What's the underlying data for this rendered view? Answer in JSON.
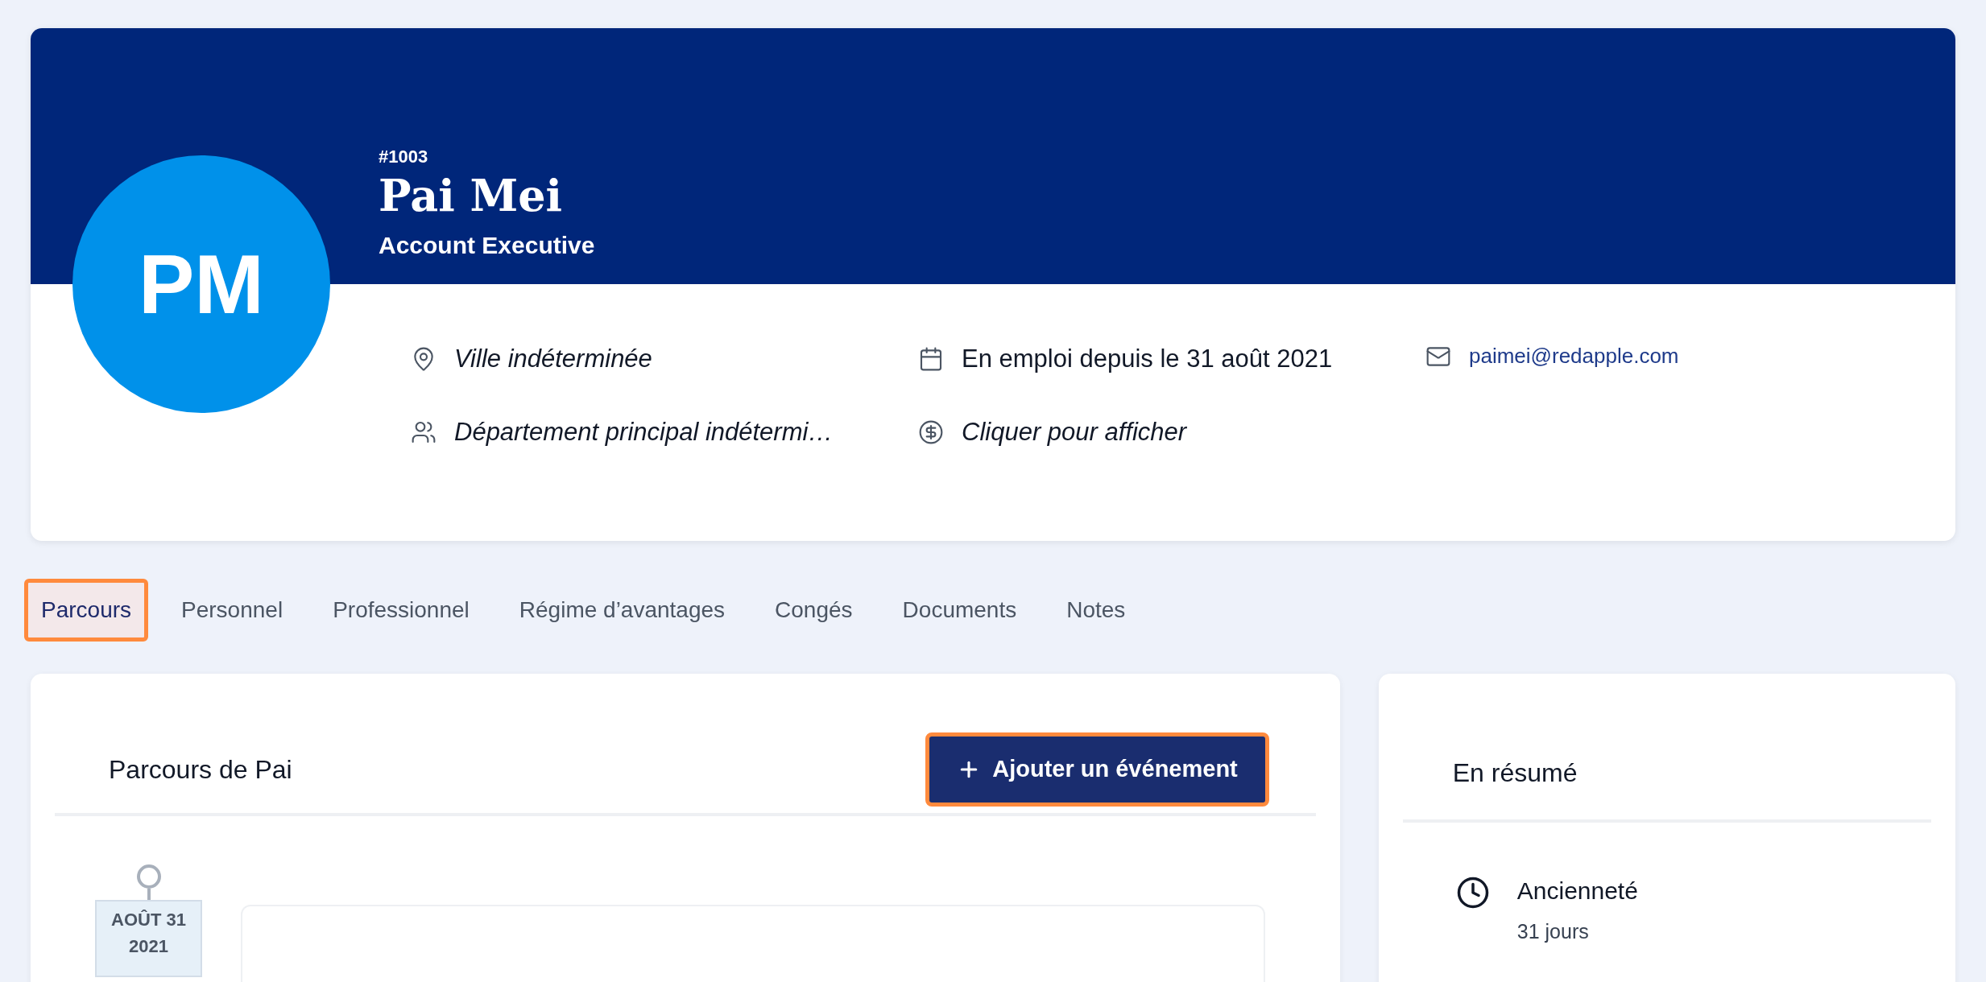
{
  "profile": {
    "initials": "PM",
    "number": "#1003",
    "name": "Pai Mei",
    "job_title": "Account Executive",
    "details": [
      {
        "kind": "location",
        "text": "Ville indéterminée",
        "italic": true
      },
      {
        "kind": "calendar",
        "text": "En emploi depuis le 31 août 2021",
        "italic": false
      },
      {
        "kind": "email",
        "text": "paimei@redapple.com",
        "italic": false
      },
      {
        "kind": "team",
        "text": "Département principal indétermi…",
        "italic": true
      },
      {
        "kind": "salary",
        "text": "Cliquer pour afficher",
        "italic": true
      }
    ]
  },
  "tabs": [
    {
      "label": "Parcours",
      "selected": true
    },
    {
      "label": "Personnel",
      "selected": false
    },
    {
      "label": "Professionnel",
      "selected": false
    },
    {
      "label": "Régime d’avantages",
      "selected": false
    },
    {
      "label": "Congés",
      "selected": false
    },
    {
      "label": "Documents",
      "selected": false
    },
    {
      "label": "Notes",
      "selected": false
    }
  ],
  "journey": {
    "title": "Parcours de Pai",
    "add_button": {
      "label": "Ajouter un événement",
      "focused": true
    },
    "events": [
      {
        "month_day": "AOÛT 31",
        "year": "2021"
      }
    ]
  },
  "summary": {
    "title": "En résumé",
    "items": [
      {
        "kind": "clock",
        "label": "Ancienneté",
        "value": "31 jours"
      }
    ]
  }
}
